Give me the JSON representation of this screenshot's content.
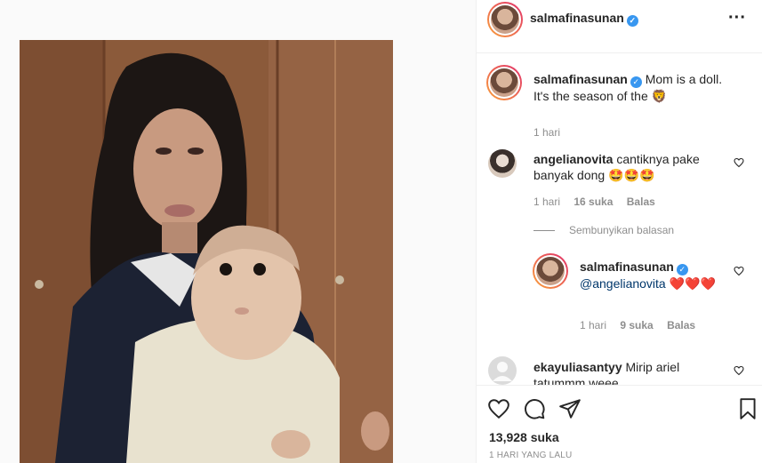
{
  "post": {
    "username": "salmafinasunan",
    "more_icon": "more-horizontal-icon"
  },
  "caption": {
    "username": "salmafinasunan",
    "text_line1": "Mom is a doll.",
    "text_line2": "It's the season of the",
    "emoji": "🦁",
    "time": "1 hari"
  },
  "comments": [
    {
      "username": "angelianovita",
      "text": "cantiknya pake banyak dong",
      "emoji": "🤩🤩🤩",
      "time": "1 hari",
      "likes": "16 suka",
      "reply_label": "Balas"
    },
    {
      "username": "salmafinasunan",
      "mention": "@angelianovita",
      "emoji": "❤️❤️❤️",
      "time": "1 hari",
      "likes": "9 suka",
      "reply_label": "Balas"
    },
    {
      "username": "ekayuliasantyy",
      "text": "Mirip ariel tatummm weee"
    }
  ],
  "hide_replies_label": "Sembunyikan balasan",
  "actions": {
    "likes": "13,928 suka",
    "timestamp": "1 HARI YANG LALU"
  },
  "colors": {
    "verified": "#3897f0",
    "secondary_text": "#8e8e8e",
    "heart": "#ed1c24"
  }
}
